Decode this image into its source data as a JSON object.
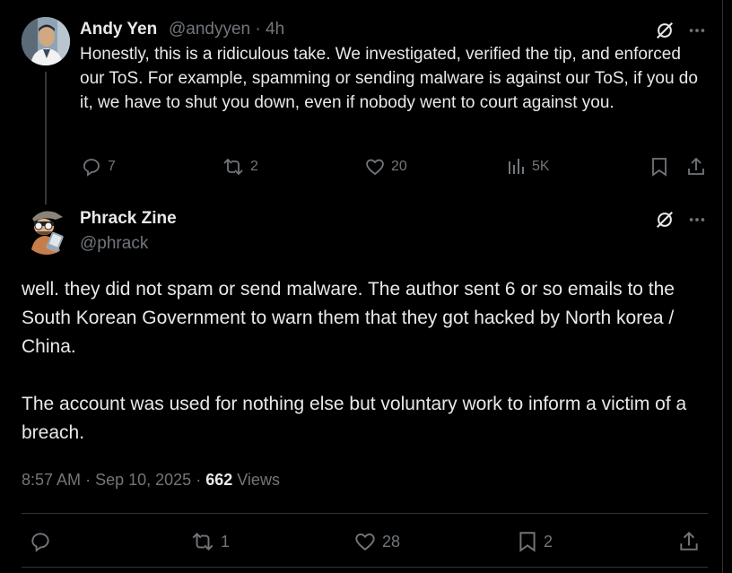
{
  "reply": {
    "author_name": "Andy Yen",
    "handle": "@andyyen",
    "separator": "·",
    "time": "4h",
    "text": "Honestly, this is a ridiculous take. We investigated, verified the tip, and enforced our ToS. For example, spamming or sending malware is against our ToS, if you do it, we have to shut you down, even if nobody went to court against you.",
    "actions": {
      "replies": "7",
      "reposts": "2",
      "likes": "20",
      "views": "5K"
    }
  },
  "main": {
    "author_name": "Phrack Zine",
    "handle": "@phrack",
    "paragraphs": [
      "well. they did not spam or send malware. The author sent 6 or so emails to the South Korean Government to warn them that they got hacked by North korea / China.",
      "The account was used for nothing else but voluntary work to inform a victim of a breach."
    ],
    "time": "8:57 AM",
    "date": "Sep 10, 2025",
    "views_count": "662",
    "views_label": "Views",
    "actions": {
      "reposts": "1",
      "likes": "28",
      "bookmarks": "2"
    }
  },
  "icons": {
    "grok": "grok-icon",
    "more": "more-icon",
    "reply": "reply-icon",
    "repost": "repost-icon",
    "like": "heart-icon",
    "views": "analytics-icon",
    "bookmark": "bookmark-icon",
    "share": "share-icon"
  },
  "colors": {
    "background": "#000000",
    "text": "#e7e9ea",
    "muted": "#71767b",
    "divider": "#2f3336"
  }
}
